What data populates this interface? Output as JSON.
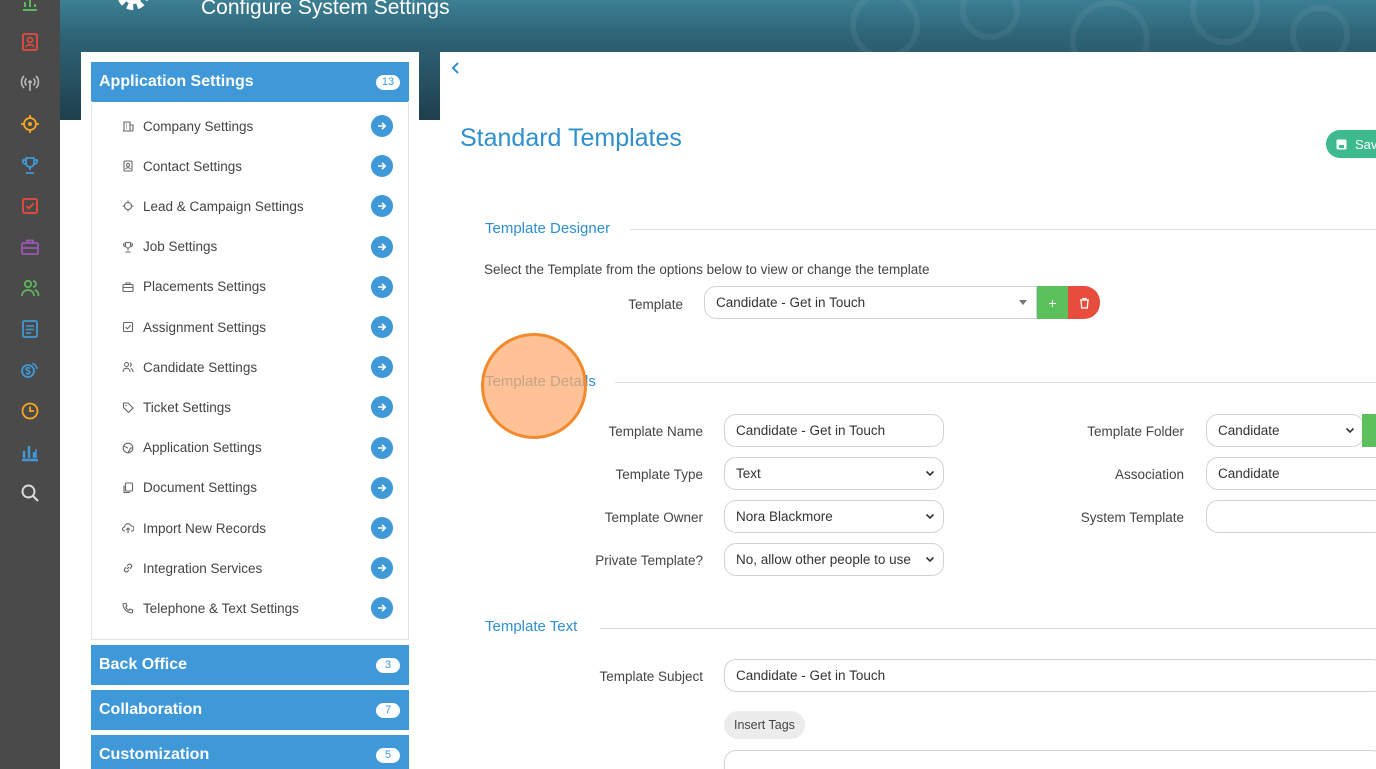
{
  "header": {
    "title": "Configure System Settings"
  },
  "rail": {
    "items": [
      {
        "icon": "bar-chart-icon",
        "color": "#5cb85c"
      },
      {
        "icon": "contact-card-icon",
        "color": "#e74c3c"
      },
      {
        "icon": "broadcast-icon",
        "color": "#bbbbbb"
      },
      {
        "icon": "crosshair-icon",
        "color": "#f5a623"
      },
      {
        "icon": "trophy-icon",
        "color": "#3f99d8"
      },
      {
        "icon": "checkbox-icon",
        "color": "#e74c3c"
      },
      {
        "icon": "briefcase-icon",
        "color": "#9b59b6"
      },
      {
        "icon": "users-icon",
        "color": "#5cb85c"
      },
      {
        "icon": "document-icon",
        "color": "#3f99d8"
      },
      {
        "icon": "money-icon",
        "color": "#3f99d8"
      },
      {
        "icon": "clock-icon",
        "color": "#f5a623"
      },
      {
        "icon": "analytics-icon",
        "color": "#3f99d8"
      },
      {
        "icon": "search-icon",
        "color": "#dddddd"
      }
    ]
  },
  "sidebar": {
    "sections": [
      {
        "label": "Application Settings",
        "badge": "13"
      },
      {
        "label": "Back Office",
        "badge": "3"
      },
      {
        "label": "Collaboration",
        "badge": "7"
      },
      {
        "label": "Customization",
        "badge": "5"
      }
    ],
    "items": [
      {
        "label": "Company Settings",
        "icon": "building-icon"
      },
      {
        "label": "Contact Settings",
        "icon": "contact-icon"
      },
      {
        "label": "Lead & Campaign Settings",
        "icon": "crosshair-icon"
      },
      {
        "label": "Job Settings",
        "icon": "trophy-icon"
      },
      {
        "label": "Placements Settings",
        "icon": "briefcase-icon"
      },
      {
        "label": "Assignment Settings",
        "icon": "checkbox-icon"
      },
      {
        "label": "Candidate Settings",
        "icon": "users-icon"
      },
      {
        "label": "Ticket Settings",
        "icon": "tag-icon"
      },
      {
        "label": "Application Settings",
        "icon": "globe-icon"
      },
      {
        "label": "Document Settings",
        "icon": "copy-icon"
      },
      {
        "label": "Import New Records",
        "icon": "cloud-upload-icon"
      },
      {
        "label": "Integration Services",
        "icon": "link-icon"
      },
      {
        "label": "Telephone & Text Settings",
        "icon": "phone-icon"
      }
    ]
  },
  "main": {
    "title": "Standard Templates",
    "save_label": "Sav",
    "designer": {
      "title": "Template Designer",
      "instruction": "Select the Template from the options below to view or change the template",
      "template_label": "Template",
      "template_value": "Candidate - Get in Touch",
      "add_label": "+"
    },
    "details": {
      "title": "Template Details",
      "name_label": "Template Name",
      "name_value": "Candidate - Get in Touch",
      "type_label": "Template Type",
      "type_value": "Text",
      "owner_label": "Template Owner",
      "owner_value": "Nora Blackmore",
      "private_label": "Private Template?",
      "private_value": "No, allow other people to use",
      "folder_label": "Template Folder",
      "folder_value": "Candidate",
      "association_label": "Association",
      "association_value": "Candidate",
      "system_label": "System Template",
      "system_value": ""
    },
    "text": {
      "title": "Template Text",
      "subject_label": "Template Subject",
      "subject_value": "Candidate - Get in Touch",
      "insert_tags_label": "Insert Tags"
    }
  },
  "colors": {
    "accent": "#3f99d8",
    "title_blue": "#2f8fcf",
    "save_green": "#3dbb8f",
    "add_green": "#5cc05c",
    "delete_red": "#e74c3c",
    "marker_orange": "#f08a2c"
  }
}
